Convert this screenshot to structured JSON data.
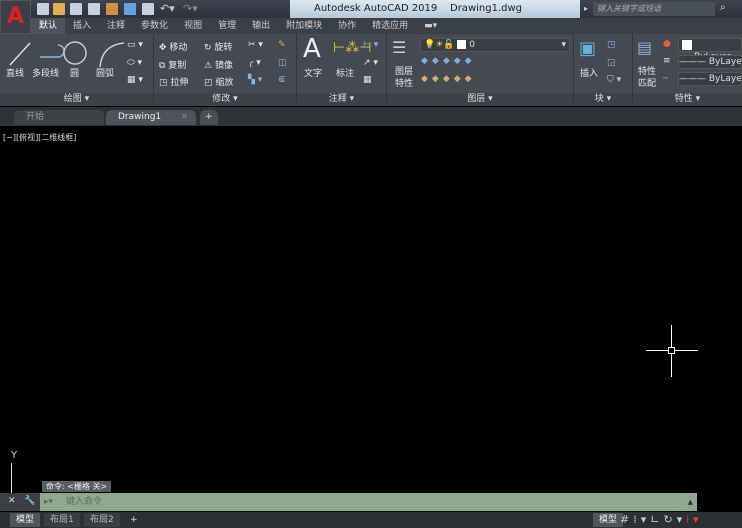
{
  "app": {
    "logo": "A",
    "title": "Autodesk AutoCAD 2019",
    "filename": "Drawing1.dwg",
    "search_placeholder": "键入关键字或短语"
  },
  "ribbon_tabs": [
    "默认",
    "插入",
    "注释",
    "参数化",
    "视图",
    "管理",
    "输出",
    "附加模块",
    "协作",
    "精选应用"
  ],
  "draw": {
    "label": "绘图",
    "line": "直线",
    "polyline": "多段线",
    "circle": "圆",
    "arc": "圆弧"
  },
  "modify": {
    "label": "修改",
    "move": "移动",
    "rotate": "旋转",
    "copy": "复制",
    "mirror": "镜像",
    "stretch": "拉伸",
    "scale": "缩放"
  },
  "annotation": {
    "label": "注释",
    "text": "文字",
    "dimension": "标注"
  },
  "layers": {
    "label": "图层",
    "layer_props": "图层\n特性",
    "current_layer": "0"
  },
  "block": {
    "label": "块",
    "insert": "插入"
  },
  "properties": {
    "label": "特性",
    "match": "特性\n匹配",
    "color": "ByLayer",
    "linetype": "ByLayer",
    "lineweight": "ByLayer"
  },
  "doc_tabs": {
    "start": "开始",
    "drawing": "Drawing1",
    "close": "✕",
    "new": "+"
  },
  "viewport_label": "[−][俯视][二维线框]",
  "ucs": {
    "y": "Y"
  },
  "command": {
    "history": "命令: <栅格 关>",
    "placeholder": "键入命令"
  },
  "layout_tabs": [
    "模型",
    "布局1",
    "布局2"
  ],
  "status": {
    "model": "模型"
  },
  "colors": {
    "command_bg": "#8fa88f",
    "ribbon": "#454a52",
    "logo_red": "#e02020"
  }
}
